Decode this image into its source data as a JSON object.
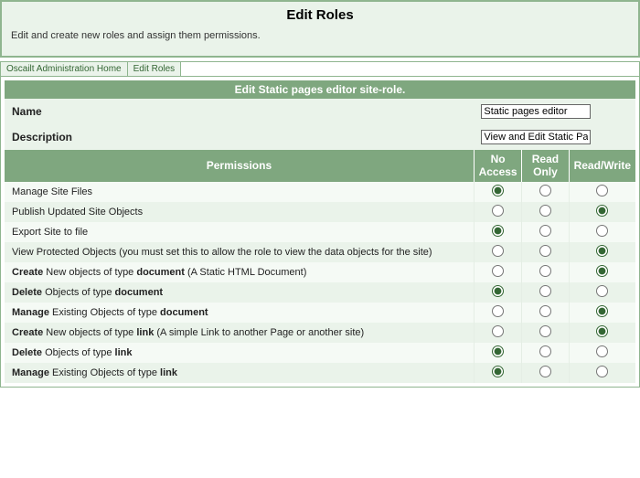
{
  "header": {
    "title": "Edit Roles",
    "description": "Edit and create new roles and assign them permissions."
  },
  "breadcrumb": {
    "items": [
      {
        "label": "Oscailt Administration Home"
      },
      {
        "label": "Edit Roles"
      }
    ]
  },
  "section_title": "Edit Static pages editor site-role.",
  "fields": {
    "name_label": "Name",
    "name_value": "Static pages editor",
    "desc_label": "Description",
    "desc_value": "View and Edit Static Pages"
  },
  "perm_headers": {
    "perms": "Permissions",
    "no_access": "No Access",
    "read_only": "Read Only",
    "read_write": "Read/Write"
  },
  "permissions": [
    {
      "label": "Manage Site Files",
      "bold_prefix": "",
      "selected": 0
    },
    {
      "label": "Publish Updated Site Objects",
      "bold_prefix": "",
      "selected": 2
    },
    {
      "label": "Export Site to file",
      "bold_prefix": "",
      "selected": 0
    },
    {
      "label": "View Protected Objects (you must set this to allow the role to view the data objects for the site)",
      "bold_prefix": "",
      "selected": 2
    },
    {
      "label_html": "<b>Create</b> New objects of type <b>document</b> (A Static HTML Document)",
      "selected": 2
    },
    {
      "label_html": "<b>Delete</b> Objects of type <b>document</b>",
      "selected": 0
    },
    {
      "label_html": "<b>Manage</b> Existing Objects of type <b>document</b>",
      "selected": 2
    },
    {
      "label_html": "<b>Create</b> New objects of type <b>link</b> (A simple Link to another Page or another site)",
      "selected": 2
    },
    {
      "label_html": "<b>Delete</b> Objects of type <b>link</b>",
      "selected": 0
    },
    {
      "label_html": "<b>Manage</b> Existing Objects of type <b>link</b>",
      "selected": 0
    }
  ]
}
